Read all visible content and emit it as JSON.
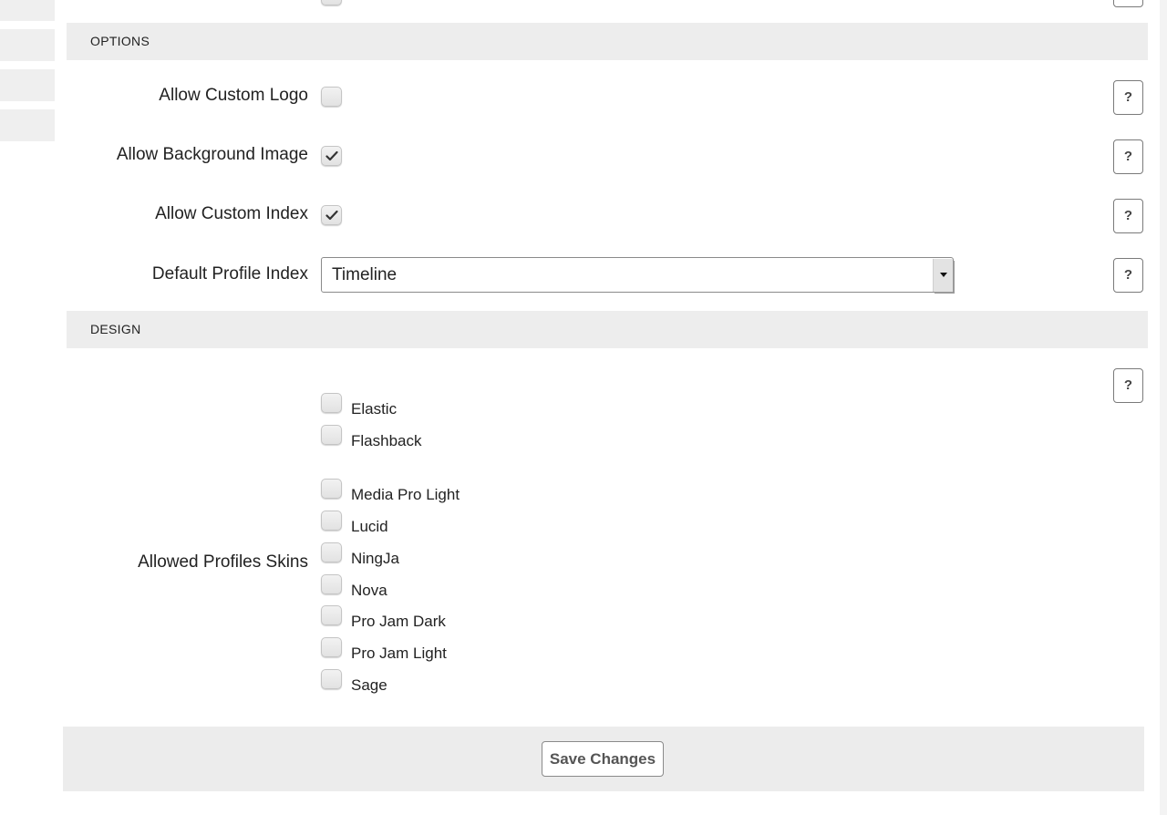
{
  "sections": {
    "options": {
      "title": "OPTIONS",
      "rows": [
        {
          "label": "Allow Custom Logo",
          "checked": false,
          "help": "?"
        },
        {
          "label": "Allow Background Image",
          "checked": true,
          "help": "?"
        },
        {
          "label": "Allow Custom Index",
          "checked": true,
          "help": "?"
        },
        {
          "label": "Default Profile Index",
          "value": "Timeline",
          "help": "?"
        }
      ]
    },
    "design": {
      "title": "DESIGN",
      "label": "Allowed Profiles Skins",
      "help": "?",
      "skins": [
        {
          "label": "Elastic",
          "checked": false
        },
        {
          "label": "Flashback",
          "checked": false
        },
        {
          "label": "Media Pro Light",
          "checked": false
        },
        {
          "label": "Lucid",
          "checked": false
        },
        {
          "label": "NingJa",
          "checked": false
        },
        {
          "label": "Nova",
          "checked": false
        },
        {
          "label": "Pro Jam Dark",
          "checked": false
        },
        {
          "label": "Pro Jam Light",
          "checked": false
        },
        {
          "label": "Sage",
          "checked": false
        }
      ]
    }
  },
  "footer": {
    "save_label": "Save Changes"
  },
  "icons": {
    "help": "question-mark",
    "check": "checkmark",
    "dropdown": "triangle-down"
  }
}
